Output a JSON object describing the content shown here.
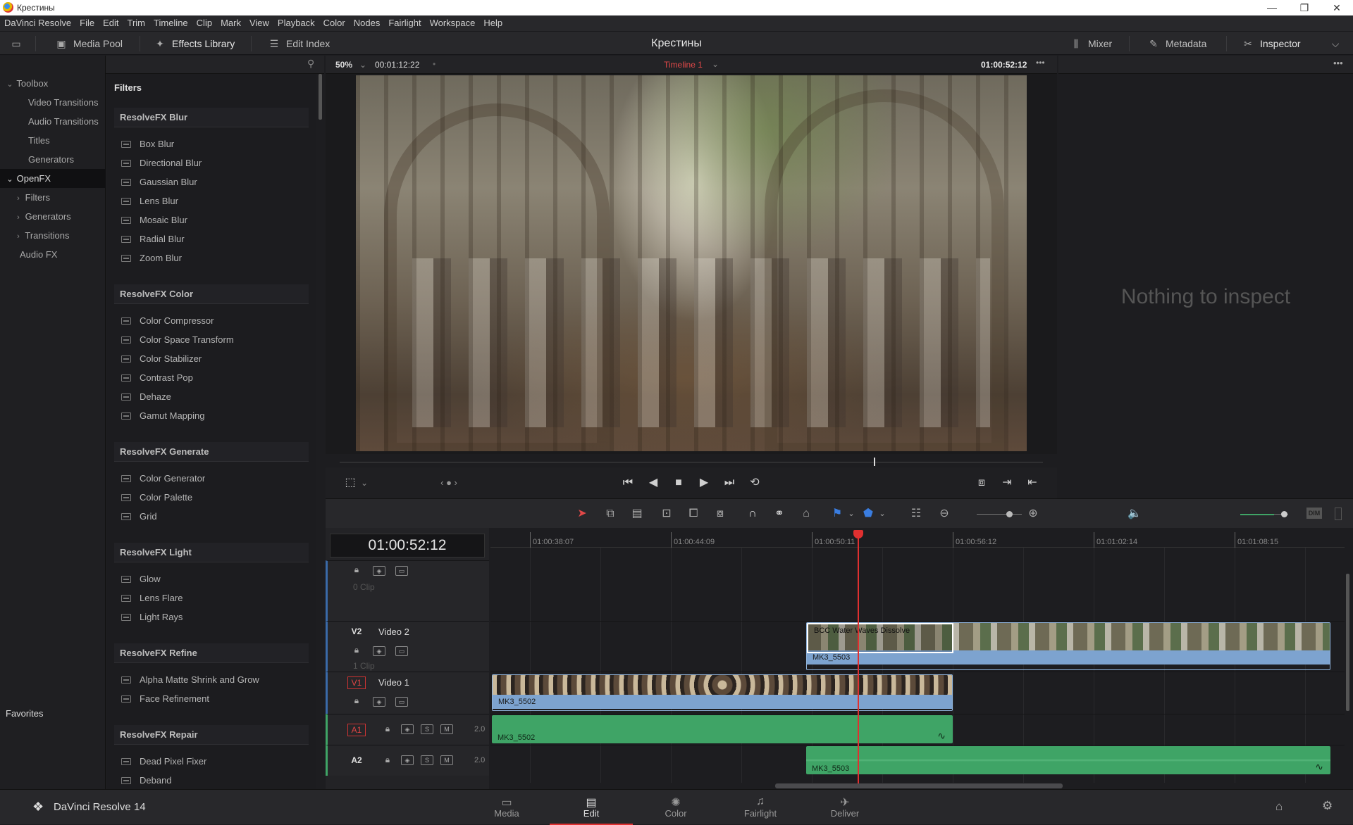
{
  "window": {
    "title": "Крестины",
    "controls": [
      "—",
      "❐",
      "✕"
    ]
  },
  "menu": [
    "DaVinci Resolve",
    "File",
    "Edit",
    "Trim",
    "Timeline",
    "Clip",
    "Mark",
    "View",
    "Playback",
    "Color",
    "Nodes",
    "Fairlight",
    "Workspace",
    "Help"
  ],
  "toolbar": {
    "media_pool": "Media Pool",
    "effects_library": "Effects Library",
    "edit_index": "Edit Index",
    "project_title": "Крестины",
    "mixer": "Mixer",
    "metadata": "Metadata",
    "inspector": "Inspector"
  },
  "sidebar": {
    "toolbox": "Toolbox",
    "video_transitions": "Video Transitions",
    "audio_transitions": "Audio Transitions",
    "titles": "Titles",
    "generators": "Generators",
    "openfx": "OpenFX",
    "filters": "Filters",
    "generators2": "Generators",
    "transitions": "Transitions",
    "audio_fx": "Audio FX",
    "favorites": "Favorites"
  },
  "filters": {
    "header": "Filters",
    "groups": [
      {
        "name": "ResolveFX Blur",
        "items": [
          "Box Blur",
          "Directional Blur",
          "Gaussian Blur",
          "Lens Blur",
          "Mosaic Blur",
          "Radial Blur",
          "Zoom Blur"
        ]
      },
      {
        "name": "ResolveFX Color",
        "items": [
          "Color Compressor",
          "Color Space Transform",
          "Color Stabilizer",
          "Contrast Pop",
          "Dehaze",
          "Gamut Mapping"
        ]
      },
      {
        "name": "ResolveFX Generate",
        "items": [
          "Color Generator",
          "Color Palette",
          "Grid"
        ]
      },
      {
        "name": "ResolveFX Light",
        "items": [
          "Glow",
          "Lens Flare",
          "Light Rays"
        ]
      },
      {
        "name": "ResolveFX Refine",
        "items": [
          "Alpha Matte Shrink and Grow",
          "Face Refinement"
        ]
      },
      {
        "name": "ResolveFX Repair",
        "items": [
          "Dead Pixel Fixer",
          "Deband"
        ]
      }
    ]
  },
  "viewer": {
    "zoom": "50%",
    "duration": "00:01:12:22",
    "timeline_name": "Timeline 1",
    "timecode": "01:00:52:12",
    "scrub_progress": 0.76
  },
  "inspector": {
    "empty_text": "Nothing to inspect"
  },
  "timeline": {
    "timecode": "01:00:52:12",
    "ruler": [
      "01:00:38:07",
      "01:00:44:09",
      "01:00:50:11",
      "01:00:56:12",
      "01:01:02:14",
      "01:01:08:15"
    ],
    "tracks": {
      "v3_count": "0 Clip",
      "v2_id": "V2",
      "v2_name": "Video 2",
      "v2_count": "1 Clip",
      "v1_id": "V1",
      "v1_name": "Video 1",
      "a1_id": "A1",
      "a1_ch": "2.0",
      "a2_id": "A2",
      "a2_ch": "2.0"
    },
    "clips": {
      "v2_transition": "BCC Water Waves Dissolve",
      "v2_clip": "MK3_5503",
      "v1_clip": "MK3_5502",
      "a1_clip": "MK3_5502",
      "a2_clip": "MK3_5503"
    }
  },
  "pages": [
    "Media",
    "Edit",
    "Color",
    "Fairlight",
    "Deliver"
  ],
  "brand": "DaVinci Resolve 14",
  "colors": {
    "accent": "#e03030",
    "video_clip": "#7da3cf",
    "audio_clip": "#3fa466"
  }
}
